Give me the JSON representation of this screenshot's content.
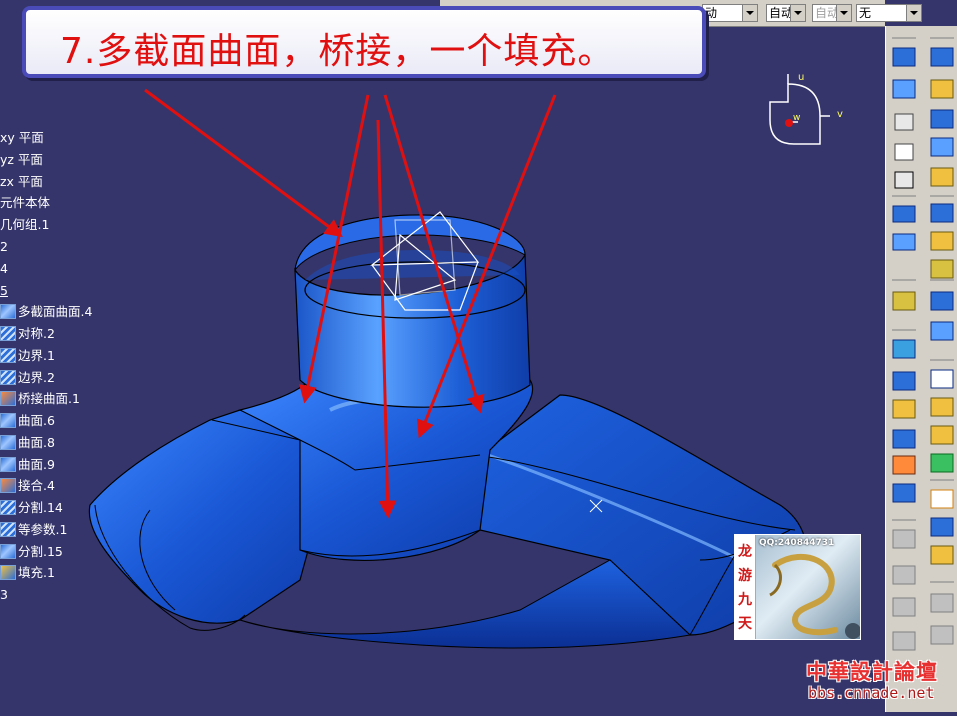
{
  "banner": {
    "text": "7.多截面曲面，桥接，一个填充。"
  },
  "toolbar": {
    "combo1": "动",
    "combo2": "自动",
    "combo3": "自动",
    "combo4": "无"
  },
  "tree": {
    "items": [
      {
        "label": "xy 平面",
        "icon": "none"
      },
      {
        "label": "yz 平面",
        "icon": "none"
      },
      {
        "label": "zx 平面",
        "icon": "none"
      },
      {
        "label": "元件本体",
        "icon": "none"
      },
      {
        "label": "几何组.1",
        "icon": "none"
      },
      {
        "label": "2",
        "icon": "none"
      },
      {
        "label": "4",
        "icon": "none"
      },
      {
        "label": "5",
        "icon": "none"
      },
      {
        "label": "多截面曲面.4",
        "icon": "multisection-surface-icon"
      },
      {
        "label": "对称.2",
        "icon": "symmetry-icon"
      },
      {
        "label": "边界.1",
        "icon": "boundary-icon"
      },
      {
        "label": "边界.2",
        "icon": "boundary-icon"
      },
      {
        "label": "桥接曲面.1",
        "icon": "blend-surface-icon"
      },
      {
        "label": "曲面.6",
        "icon": "surface-icon"
      },
      {
        "label": "曲面.8",
        "icon": "surface-icon"
      },
      {
        "label": "曲面.9",
        "icon": "surface-icon"
      },
      {
        "label": "接合.4",
        "icon": "join-icon"
      },
      {
        "label": "分割.14",
        "icon": "split-icon"
      },
      {
        "label": "等参数.1",
        "icon": "isoparametric-icon"
      },
      {
        "label": "分割.15",
        "icon": "split-icon"
      },
      {
        "label": "填充.1",
        "icon": "fill-icon"
      },
      {
        "label": "3",
        "icon": "none"
      }
    ]
  },
  "compass": {
    "u": "u",
    "v": "v",
    "w": "w"
  },
  "logo": {
    "qq": "QQ:240844731",
    "chars": [
      "龙",
      "游",
      "九",
      "天"
    ]
  },
  "watermark": {
    "title": "中華設計論壇",
    "url": "bbs.cnnade.net"
  },
  "colors": {
    "background": "#35356b",
    "part": "#1f5fd8",
    "arrow": "#e01010",
    "banner_border": "#4a4ab8"
  }
}
